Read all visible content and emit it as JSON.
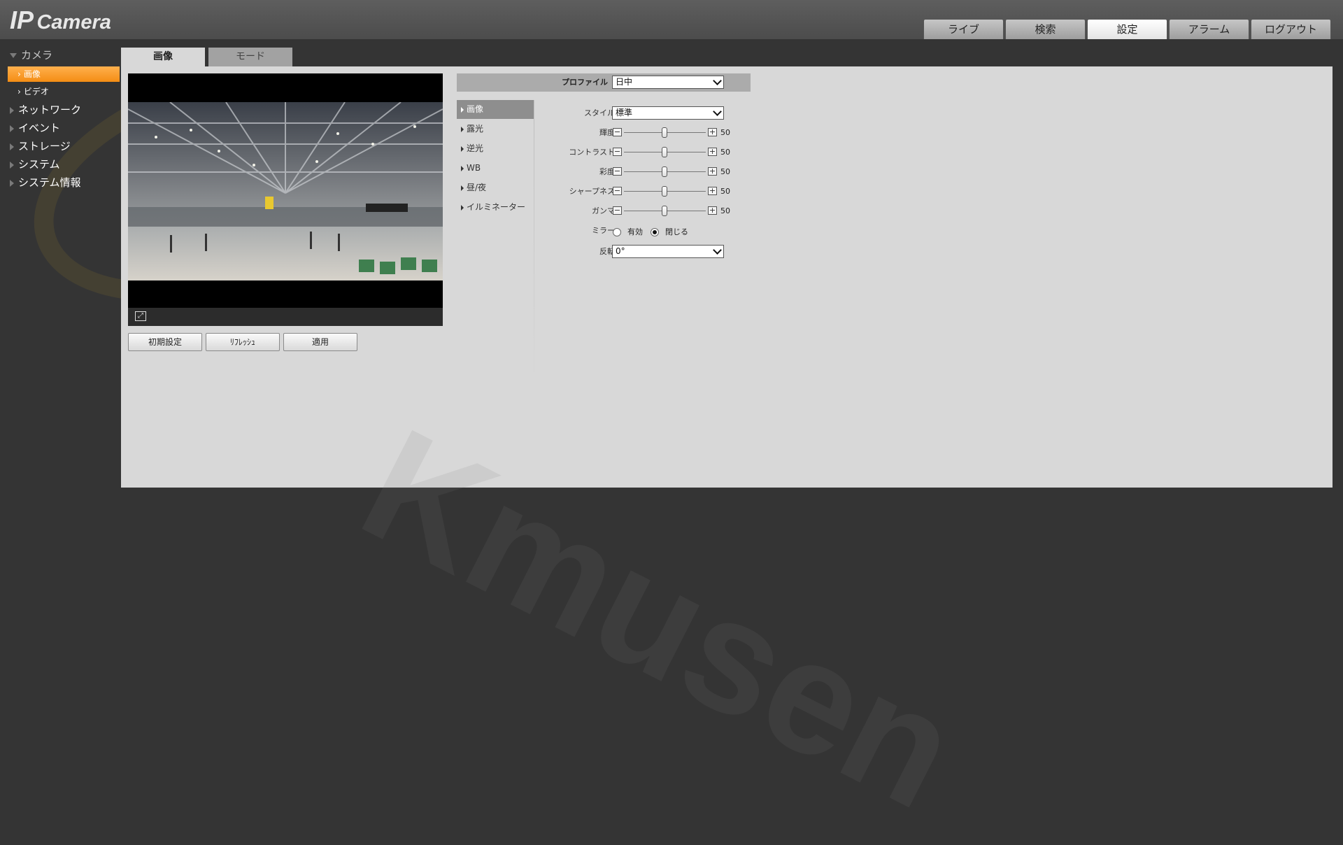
{
  "header": {
    "logo_ip": "IP",
    "logo_camera": "Camera",
    "nav": [
      {
        "label": "ライブ"
      },
      {
        "label": "検索"
      },
      {
        "label": "設定"
      },
      {
        "label": "アラーム"
      },
      {
        "label": "ログアウト"
      }
    ],
    "active_nav": "設定"
  },
  "sidebar": {
    "camera": "カメラ",
    "camera_items": [
      {
        "label": "画像"
      },
      {
        "label": "ビデオ"
      }
    ],
    "sections": [
      {
        "label": "ネットワーク"
      },
      {
        "label": "イベント"
      },
      {
        "label": "ストレージ"
      },
      {
        "label": "システム"
      },
      {
        "label": "システム情報"
      }
    ]
  },
  "tabs": [
    {
      "label": "画像"
    },
    {
      "label": "モード"
    }
  ],
  "buttons": {
    "default": "初期設定",
    "refresh": "ﾘﾌﾚｯｼｭ",
    "apply": "適用"
  },
  "profile": {
    "label": "プロファイル",
    "value": "日中"
  },
  "submenu": [
    {
      "label": "画像"
    },
    {
      "label": "露光"
    },
    {
      "label": "逆光"
    },
    {
      "label": "WB"
    },
    {
      "label": "昼/夜"
    },
    {
      "label": "イルミネーター"
    }
  ],
  "settings": {
    "style_label": "スタイル",
    "style_value": "標準",
    "sliders": [
      {
        "label": "輝度",
        "value": "50"
      },
      {
        "label": "コントラスト",
        "value": "50"
      },
      {
        "label": "彩度",
        "value": "50"
      },
      {
        "label": "シャープネス",
        "value": "50"
      },
      {
        "label": "ガンマ",
        "value": "50"
      }
    ],
    "mirror_label": "ミラー",
    "mirror_on": "有効",
    "mirror_off": "閉じる",
    "mirror_selected": "閉じる",
    "flip_label": "反転",
    "flip_value": "0°"
  },
  "watermark": "Kmusen",
  "colors": {
    "accent_orange": "#f48d14",
    "background": "#343434",
    "panel": "#d8d8d8"
  }
}
